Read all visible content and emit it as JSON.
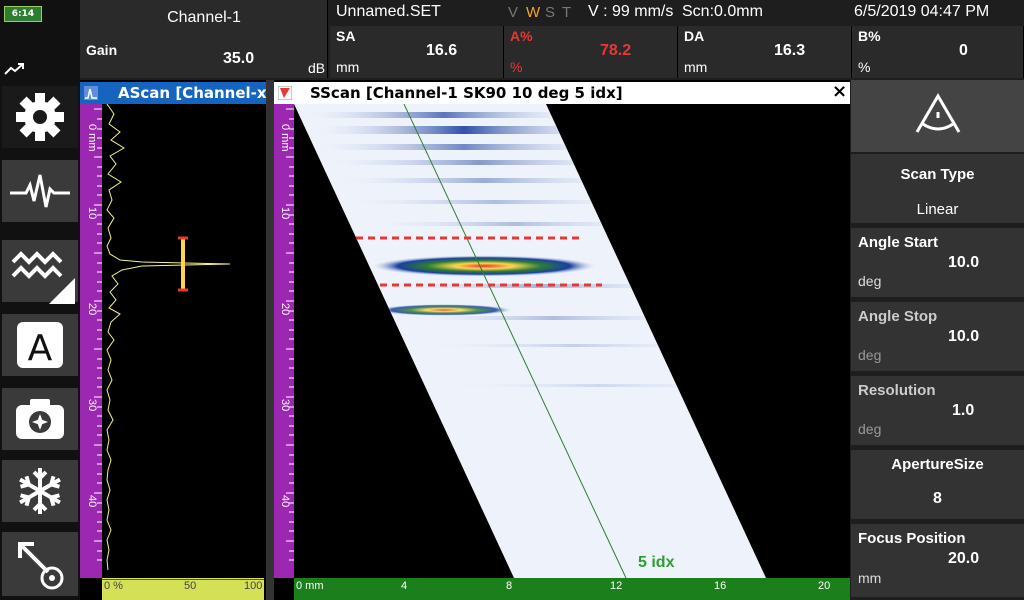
{
  "status": {
    "battery": "6:14"
  },
  "header": {
    "channel": "Channel-1",
    "setup": "Unnamed.SET",
    "letters": [
      "V",
      "W",
      "S",
      "T"
    ],
    "velocity": "V : 99 mm/s",
    "scan_pos": "Scn:0.0mm",
    "datetime": "6/5/2019 04:47 PM",
    "gain": {
      "label": "Gain",
      "value": "35.0",
      "unit": "dB"
    },
    "sa": {
      "label": "SA",
      "value": "16.6",
      "unit": "mm"
    },
    "a_pct": {
      "label": "A%",
      "value": "78.2",
      "unit": "%"
    },
    "da": {
      "label": "DA",
      "value": "16.3",
      "unit": "mm"
    },
    "b_pct": {
      "label": "B%",
      "value": "0",
      "unit": "%"
    }
  },
  "ascan": {
    "title": "AScan [Channel-x...",
    "v_ticks": [
      "0 mm",
      "10",
      "20",
      "30",
      "40"
    ],
    "h_ticks": [
      "0 %",
      "50",
      "100"
    ]
  },
  "sscan": {
    "title": "SScan [Channel-1 SK90 10 deg 5 idx]",
    "close": "×",
    "cursor_label": "5 idx",
    "v_ticks": [
      "0 mm",
      "10",
      "20",
      "30",
      "40"
    ],
    "h_ticks": [
      "0 mm",
      "4",
      "8",
      "12",
      "16",
      "20"
    ]
  },
  "right_panel": {
    "scan_type": {
      "label": "Scan Type",
      "value": "Linear"
    },
    "angle_start": {
      "label": "Angle Start",
      "value": "10.0",
      "unit": "deg"
    },
    "angle_stop": {
      "label": "Angle Stop",
      "value": "10.0",
      "unit": "deg"
    },
    "resolution": {
      "label": "Resolution",
      "value": "1.0",
      "unit": "deg"
    },
    "aperture": {
      "label": "ApertureSize",
      "value": "8"
    },
    "focus": {
      "label": "Focus Position",
      "value": "20.0",
      "unit": "mm"
    }
  },
  "colors": {
    "accent_blue": "#1565c0",
    "ruler_purple": "#9c27b0",
    "ruler_green": "#1b7f1b",
    "gate_yellow": "#ffd54f"
  }
}
